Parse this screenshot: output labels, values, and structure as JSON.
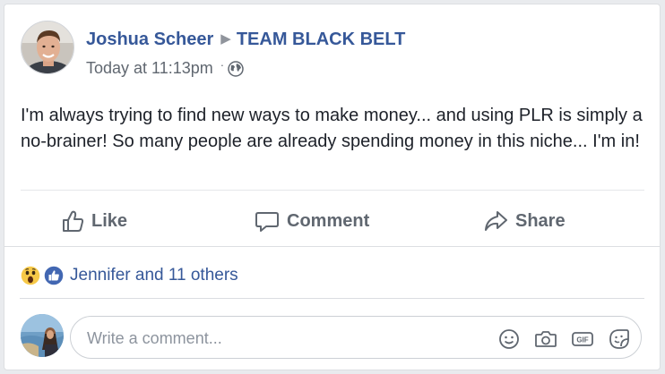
{
  "post": {
    "author": "Joshua Scheer",
    "group": "TEAM BLACK BELT",
    "separator_icon": "triangle-right-icon",
    "time": "Today at 11:13pm",
    "privacy_icon": "globe-icon",
    "text": "I'm always trying to find new ways to make money... and using PLR is simply a no-brainer! So many people are already spending money in this niche... I'm in!"
  },
  "actions": {
    "like_label": "Like",
    "comment_label": "Comment",
    "share_label": "Share"
  },
  "reactions": {
    "icons": [
      "wow-reaction-icon",
      "like-reaction-icon"
    ],
    "summary": "Jennifer and 11 others"
  },
  "comment_composer": {
    "placeholder": "Write a comment...",
    "icons": [
      "emoji-icon",
      "camera-icon",
      "gif-icon",
      "sticker-icon"
    ]
  },
  "colors": {
    "link": "#365899",
    "muted": "#606770",
    "like_blue": "#4267b2",
    "wow_yellow": "#f7c948",
    "background": "#e9ebee"
  }
}
